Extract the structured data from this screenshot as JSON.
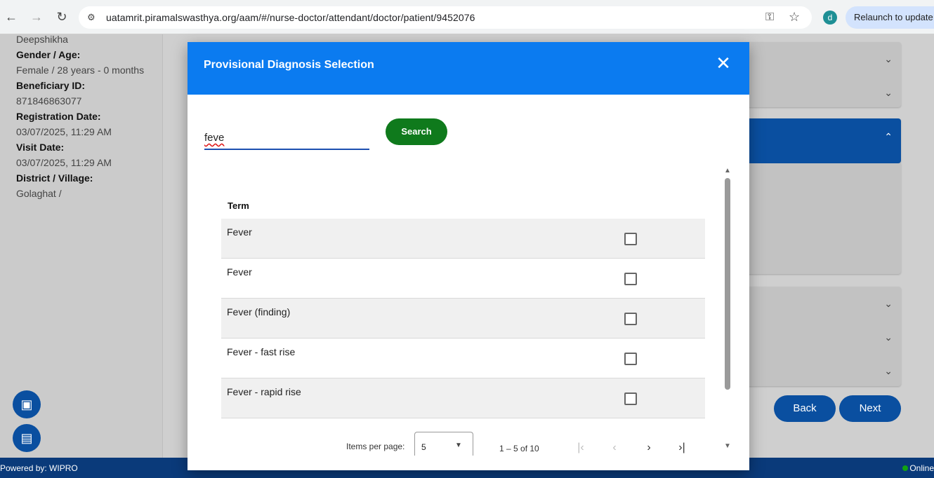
{
  "browser": {
    "url": "uatamrit.piramalswasthya.org/aam/#/nurse-doctor/attendant/doctor/patient/9452076",
    "profile_initial": "d",
    "relaunch_label": "Relaunch to update"
  },
  "sidebar": {
    "name": "Deepshikha",
    "gender_age_label": "Gender / Age:",
    "gender_age_value": "Female / 28 years - 0 months",
    "beneficiary_id_label": "Beneficiary ID:",
    "beneficiary_id_value": "871846863077",
    "registration_date_label": "Registration Date:",
    "registration_date_value": "03/07/2025, 11:29 AM",
    "visit_date_label": "Visit Date:",
    "visit_date_value": "03/07/2025, 11:29 AM",
    "district_label": "District / Village:",
    "district_value": "Golaghat /"
  },
  "background": {
    "back_label": "Back",
    "next_label": "Next"
  },
  "footer": {
    "powered_by": "Powered by: WIPRO",
    "status": "Online"
  },
  "modal": {
    "title": "Provisional Diagnosis Selection",
    "search_value": "feve",
    "search_button": "Search",
    "column_term": "Term",
    "rows": [
      {
        "term": "Fever"
      },
      {
        "term": "Fever"
      },
      {
        "term": "Fever (finding)"
      },
      {
        "term": "Fever - fast rise"
      },
      {
        "term": "Fever - rapid rise"
      }
    ],
    "paginator": {
      "items_per_page_label": "Items per page:",
      "items_per_page_value": "5",
      "range_label": "1 – 5 of 10"
    }
  },
  "colors": {
    "modal_header": "#0b7bf0",
    "search_button": "#0f7a1c",
    "primary_dark": "#0a4fa0"
  }
}
